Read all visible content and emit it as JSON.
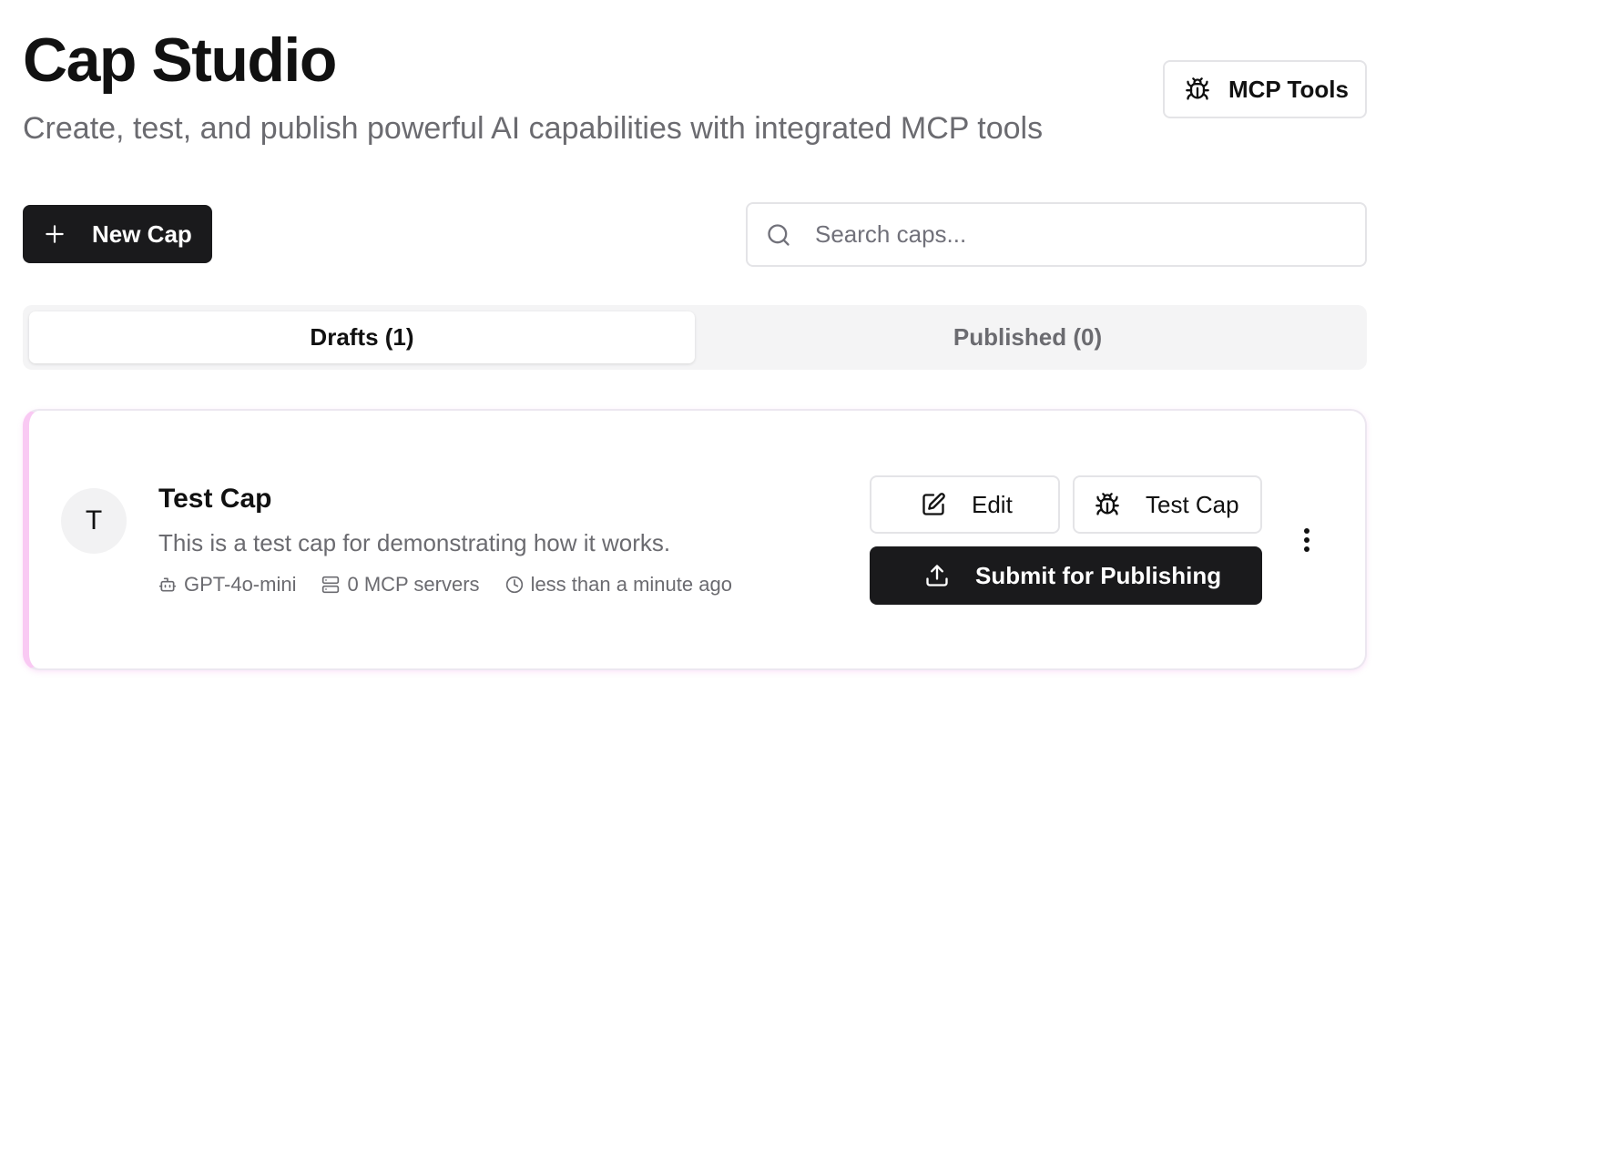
{
  "header": {
    "title": "Cap Studio",
    "subtitle": "Create, test, and publish powerful AI capabilities with integrated MCP tools",
    "mcp_tools_label": "MCP Tools",
    "mcp_tools_icon": "bug-icon"
  },
  "toolbar": {
    "new_cap_label": "New Cap",
    "new_cap_icon": "plus-icon",
    "search_placeholder": "Search caps...",
    "search_value": ""
  },
  "tabs": [
    {
      "label": "Drafts (1)",
      "active": true
    },
    {
      "label": "Published (0)",
      "active": false
    }
  ],
  "caps": [
    {
      "avatar_letter": "T",
      "name": "Test Cap",
      "description": "This is a test cap for demonstrating how it works.",
      "model": "GPT-4o-mini",
      "servers": "0 MCP servers",
      "updated": "less than a minute ago",
      "edit_label": "Edit",
      "test_label": "Test Cap",
      "submit_label": "Submit for Publishing"
    }
  ],
  "colors": {
    "primary_dark": "#1a1a1c",
    "muted_text": "#6b6b70",
    "card_accent": "#f9c9f3"
  }
}
